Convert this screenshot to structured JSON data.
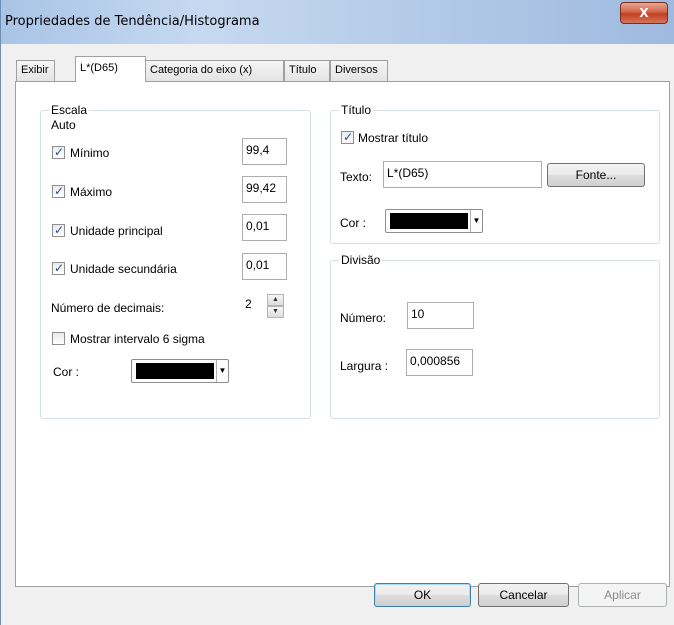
{
  "window": {
    "title": "Propriedades de Tendência/Histograma",
    "close_label": "X"
  },
  "tabs": [
    {
      "label": "Exibir"
    },
    {
      "label": "L*(D65)"
    },
    {
      "label": "Categoria do eixo  (x)"
    },
    {
      "label": "Título"
    },
    {
      "label": "Diversos"
    }
  ],
  "escala": {
    "group_label": "Escala",
    "auto_label": "Auto",
    "minimo": {
      "label": "Mínimo",
      "checked": true,
      "value": "99,4"
    },
    "maximo": {
      "label": "Máximo",
      "checked": true,
      "value": "99,42"
    },
    "unidade_principal": {
      "label": "Unidade principal",
      "checked": true,
      "value": "0,01"
    },
    "unidade_secundaria": {
      "label": "Unidade secundária",
      "checked": true,
      "value": "0,01"
    },
    "decimais": {
      "label": "Número de decimais:",
      "value": "2"
    },
    "sigma": {
      "label": "Mostrar intervalo 6 sigma",
      "checked": false
    },
    "cor": {
      "label": "Cor :",
      "color": "#000000"
    }
  },
  "titulo": {
    "group_label": "Título",
    "mostrar": {
      "label": "Mostrar título",
      "checked": true
    },
    "texto": {
      "label": "Texto:",
      "value": "L*(D65)"
    },
    "fonte_button": "Fonte...",
    "cor": {
      "label": "Cor :",
      "color": "#000000"
    }
  },
  "divisao": {
    "group_label": "Divisão",
    "numero": {
      "label": "Número:",
      "value": "10"
    },
    "largura": {
      "label": "Largura :",
      "value": "0,000856"
    }
  },
  "buttons": {
    "ok": "OK",
    "cancel": "Cancelar",
    "apply": "Aplicar"
  },
  "icons": {
    "check": "✓",
    "close": "close-icon",
    "dropdown": "chevron-down-icon"
  }
}
